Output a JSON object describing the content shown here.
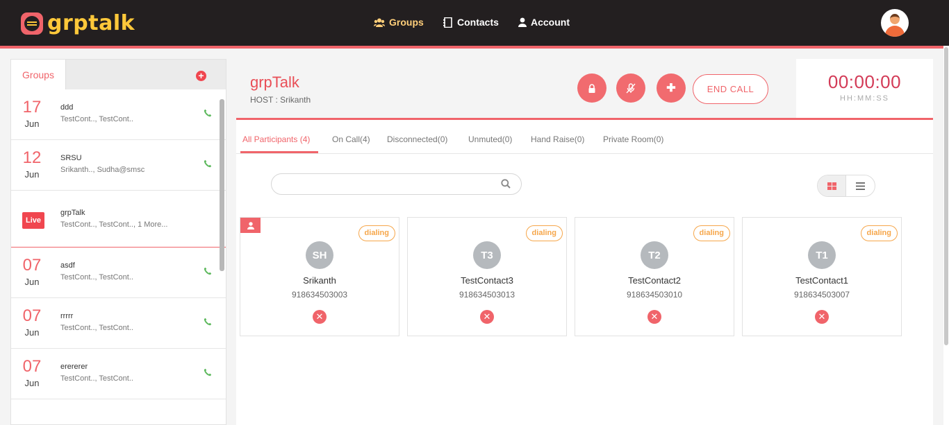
{
  "app": {
    "logo_text": "grptalk"
  },
  "nav": {
    "groups_label": "Groups",
    "contacts_label": "Contacts",
    "account_label": "Account",
    "groups_icon": "users-icon",
    "contacts_icon": "address-book-icon",
    "account_icon": "user-icon"
  },
  "sidebar": {
    "tab_label": "Groups",
    "add_icon": "plus-circle-icon",
    "groups": [
      {
        "day": "17",
        "month": "Jun",
        "name": "ddd",
        "members": "TestCont.., TestCont..",
        "live": false
      },
      {
        "day": "12",
        "month": "Jun",
        "name": "SRSU",
        "members": "Srikanth.., Sudha@smsc",
        "live": false
      },
      {
        "live_label": "Live",
        "name": "grpTalk",
        "members": "TestCont.., TestCont..,  1 More...",
        "live": true
      },
      {
        "day": "07",
        "month": "Jun",
        "name": "asdf",
        "members": "TestCont.., TestCont..",
        "live": false
      },
      {
        "day": "07",
        "month": "Jun",
        "name": "rrrrr",
        "members": "TestCont.., TestCont..",
        "live": false
      },
      {
        "day": "07",
        "month": "Jun",
        "name": "erererer",
        "members": "TestCont.., TestCont..",
        "live": false
      }
    ]
  },
  "call": {
    "title": "grpTalk",
    "host": "HOST : Srikanth",
    "end_call_label": "END CALL",
    "timer": "00:00:00",
    "timer_format": "HH:MM:SS"
  },
  "tabs": [
    {
      "label": "All Participants (4)",
      "active": true
    },
    {
      "label": "On Call(4)",
      "active": false
    },
    {
      "label": "Disconnected(0)",
      "active": false
    },
    {
      "label": "Unmuted(0)",
      "active": false
    },
    {
      "label": "Hand Raise(0)",
      "active": false
    },
    {
      "label": "Private Room(0)",
      "active": false
    }
  ],
  "search": {
    "placeholder": ""
  },
  "participants": [
    {
      "initials": "SH",
      "name": "Srikanth",
      "number": "918634503003",
      "status": "dialing",
      "host": true
    },
    {
      "initials": "T3",
      "name": "TestContact3",
      "number": "918634503013",
      "status": "dialing",
      "host": false
    },
    {
      "initials": "T2",
      "name": "TestContact2",
      "number": "918634503010",
      "status": "dialing",
      "host": false
    },
    {
      "initials": "T1",
      "name": "TestContact1",
      "number": "918634503007",
      "status": "dialing",
      "host": false
    }
  ],
  "colors": {
    "accent": "#f0646a",
    "logo": "#ffc83a",
    "status": "#f6a64a",
    "topbar": "#231f20"
  }
}
